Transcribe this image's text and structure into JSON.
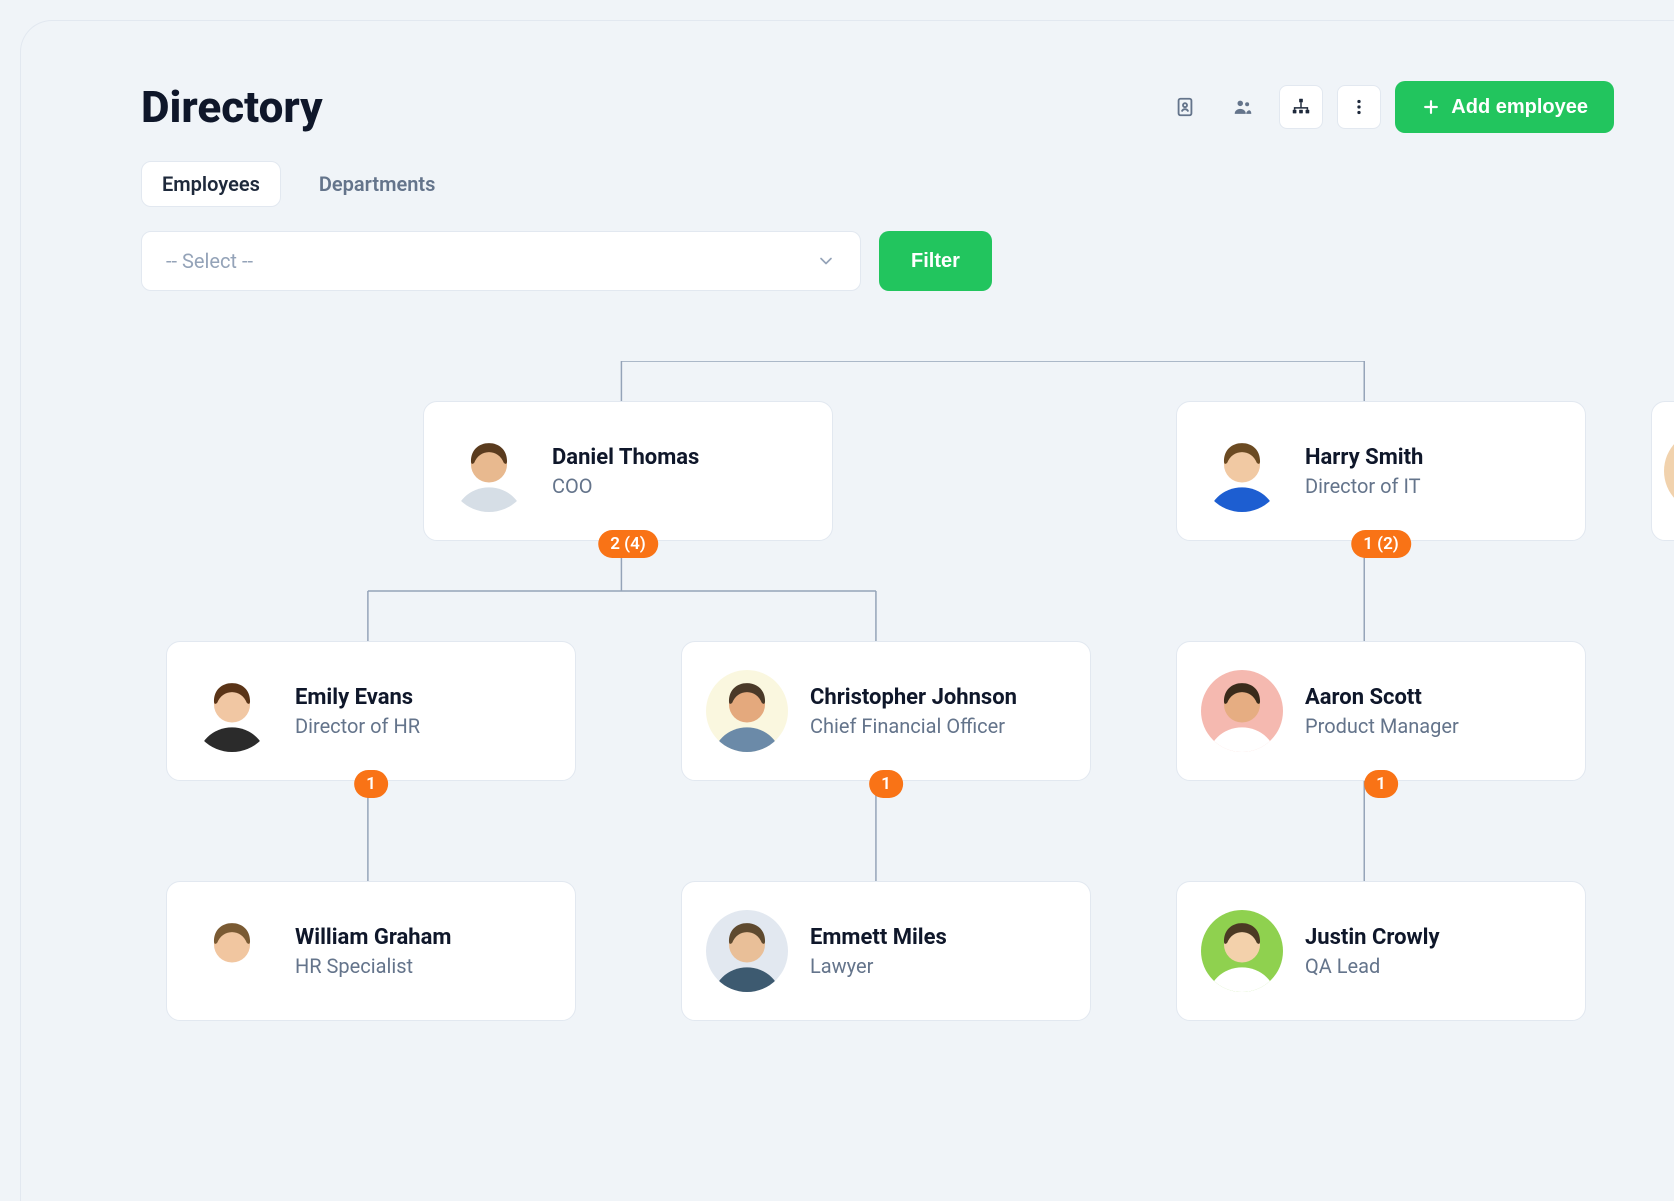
{
  "page": {
    "title": "Directory"
  },
  "tabs": {
    "employees": "Employees",
    "departments": "Departments"
  },
  "select": {
    "placeholder": "-- Select --"
  },
  "buttons": {
    "filter": "Filter",
    "add_employee": "Add employee"
  },
  "nodes": {
    "daniel": {
      "name": "Daniel Thomas",
      "role": "COO",
      "badge": "2 (4)",
      "avatar_bg": "#ffffff",
      "avatar_skin": "#e8b98f",
      "avatar_hair": "#5a3b1e",
      "avatar_shirt": "#d6dee6"
    },
    "harry": {
      "name": "Harry Smith",
      "role": "Director of IT",
      "badge": "1 (2)",
      "avatar_bg": "#ffffff",
      "avatar_skin": "#f1c9a3",
      "avatar_hair": "#6b4a22",
      "avatar_shirt": "#1d5ed1"
    },
    "emily": {
      "name": "Emily Evans",
      "role": "Director of HR",
      "badge": "1",
      "avatar_bg": "#ffffff",
      "avatar_skin": "#f1c7a3",
      "avatar_hair": "#5a3417",
      "avatar_shirt": "#2b2b2b"
    },
    "chris": {
      "name": "Christopher Johnson",
      "role": "Chief Financial Officer",
      "badge": "1",
      "avatar_bg": "#faf7df",
      "avatar_skin": "#e4a97d",
      "avatar_hair": "#4a3928",
      "avatar_shirt": "#6b8aa8"
    },
    "aaron": {
      "name": "Aaron Scott",
      "role": "Product Manager",
      "badge": "1",
      "avatar_bg": "#f5b9b0",
      "avatar_skin": "#e6ad82",
      "avatar_hair": "#3a2b1b",
      "avatar_shirt": "#ffffff"
    },
    "william": {
      "name": "William Graham",
      "role": "HR Specialist",
      "badge": "",
      "avatar_bg": "#ffffff",
      "avatar_skin": "#f1c6a0",
      "avatar_hair": "#7a5a33",
      "avatar_shirt": "#ffffff"
    },
    "emmett": {
      "name": "Emmett Miles",
      "role": "Lawyer",
      "badge": "",
      "avatar_bg": "#e2e8f0",
      "avatar_skin": "#e9bf98",
      "avatar_hair": "#5f4a2f",
      "avatar_shirt": "#3d5a70"
    },
    "justin": {
      "name": "Justin Crowly",
      "role": "QA Lead",
      "badge": "",
      "avatar_bg": "#8fd14f",
      "avatar_skin": "#f3d1ab",
      "avatar_hair": "#4b3a24",
      "avatar_shirt": "#ffffff"
    }
  }
}
